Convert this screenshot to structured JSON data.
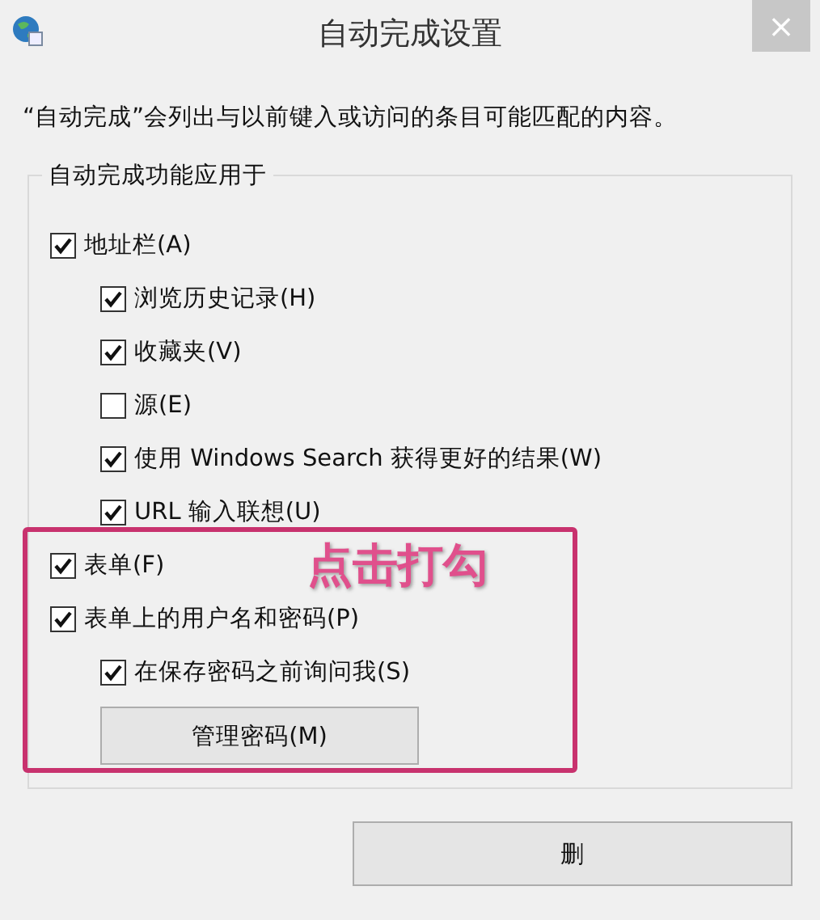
{
  "window": {
    "title": "自动完成设置",
    "close": "×"
  },
  "description": "“自动完成”会列出与以前键入或访问的条目可能匹配的内容。",
  "autocomplete_group": {
    "label": "自动完成功能应用于",
    "options": [
      {
        "label": "地址栏(A)",
        "checked": true,
        "children": [
          {
            "label": "浏览历史记录(H)",
            "checked": true
          },
          {
            "label": "收藏夹(V)",
            "checked": true
          },
          {
            "label": "源(E)",
            "checked": false
          },
          {
            "label": "使用 Windows Search 获得更好的结果(W)",
            "checked": true
          },
          {
            "label": "URL 输入联想(U)",
            "checked": true
          }
        ]
      },
      {
        "label": "表单(F)",
        "checked": true
      },
      {
        "label": "表单上的用户名和密码(P)",
        "checked": true,
        "children": [
          {
            "label": "在保存密码之前询问我(S)",
            "checked": true
          }
        ]
      }
    ],
    "button": "管理密码(M)"
  },
  "annotation": {
    "text": "点击打勾"
  },
  "buttons": [
    "删"
  ]
}
